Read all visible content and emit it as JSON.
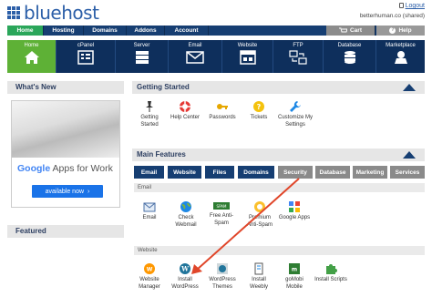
{
  "header": {
    "logo_text": "bluehost",
    "logout_label": "Logout",
    "user_info": "betterhuman.co (shared)"
  },
  "topnav": {
    "items": [
      {
        "label": "Home"
      },
      {
        "label": "Hosting"
      },
      {
        "label": "Domains"
      },
      {
        "label": "Addons"
      },
      {
        "label": "Account"
      }
    ],
    "cart_label": "Cart",
    "help_label": "Help"
  },
  "iconbar": {
    "items": [
      {
        "label": "Home",
        "icon": "house-icon"
      },
      {
        "label": "cPanel",
        "icon": "cpanel-icon"
      },
      {
        "label": "Server",
        "icon": "server-icon"
      },
      {
        "label": "Email",
        "icon": "envelope-icon"
      },
      {
        "label": "Website",
        "icon": "website-icon"
      },
      {
        "label": "FTP",
        "icon": "ftp-icon"
      },
      {
        "label": "Database",
        "icon": "database-icon"
      },
      {
        "label": "Marketplace",
        "icon": "marketplace-icon"
      }
    ]
  },
  "sidebar": {
    "whats_new": "What's New",
    "promo_google": "Google",
    "promo_rest": "Apps for Work",
    "promo_button": "available now",
    "featured": "Featured"
  },
  "getting_started": {
    "title": "Getting Started",
    "items": [
      {
        "label": "Getting Started"
      },
      {
        "label": "Help Center"
      },
      {
        "label": "Passwords"
      },
      {
        "label": "Tickets"
      },
      {
        "label": "Customize My Settings"
      }
    ]
  },
  "main_features": {
    "title": "Main Features",
    "tabs": [
      "Email",
      "Website",
      "Files",
      "Domains",
      "Security",
      "Database",
      "Marketing",
      "Services"
    ],
    "email_section": "Email",
    "email_items": [
      {
        "label": "Email"
      },
      {
        "label": "Check Webmail"
      },
      {
        "label": "Free Anti-Spam"
      },
      {
        "label": "Premium Anti-Spam"
      },
      {
        "label": "Google Apps"
      }
    ],
    "website_section": "Website",
    "website_items": [
      {
        "label": "Website Manager"
      },
      {
        "label": "Install WordPress"
      },
      {
        "label": "WordPress Themes"
      },
      {
        "label": "Install Weebly"
      },
      {
        "label": "goMobi Mobile"
      },
      {
        "label": "Install Scripts"
      }
    ]
  },
  "colors": {
    "nav_blue": "#163e72",
    "active_green": "#2aa65a",
    "arrow_red": "#e0462a"
  }
}
